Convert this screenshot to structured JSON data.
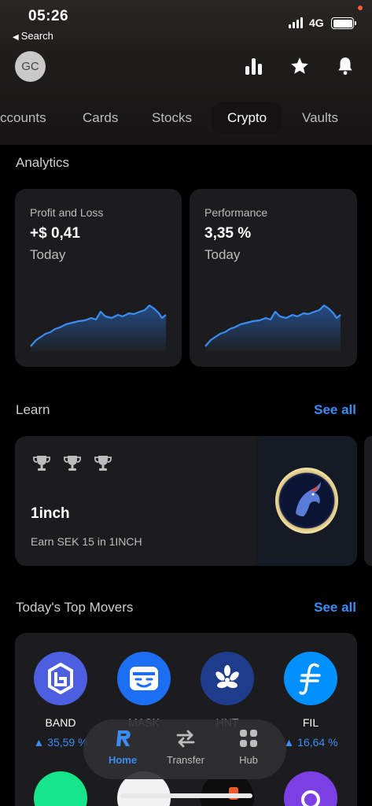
{
  "status_bar": {
    "time": "05:26",
    "back_label": "Search",
    "network": "4G"
  },
  "header": {
    "avatar_initials": "GC"
  },
  "tabs": [
    {
      "label": "ccounts"
    },
    {
      "label": "Cards"
    },
    {
      "label": "Stocks"
    },
    {
      "label": "Crypto",
      "active": true
    },
    {
      "label": "Vaults"
    }
  ],
  "analytics": {
    "title": "Analytics",
    "profit_loss": {
      "label": "Profit and Loss",
      "value": "+$ 0,41",
      "period": "Today"
    },
    "performance": {
      "label": "Performance",
      "value": "3,35 %",
      "period": "Today"
    }
  },
  "learn": {
    "title": "Learn",
    "see_all": "See all",
    "card": {
      "title": "1inch",
      "subtitle": "Earn SEK 15 in 1INCH"
    }
  },
  "movers": {
    "title": "Today's Top Movers",
    "see_all": "See all",
    "items": [
      {
        "symbol": "BAND",
        "change": "▲ 35,59 %",
        "color": "#4c5fe0"
      },
      {
        "symbol": "MASK",
        "change": "",
        "color": "#1c6ef2"
      },
      {
        "symbol": "HNT",
        "change": "",
        "color": "#1f3c8c"
      },
      {
        "symbol": "FIL",
        "change": "▲ 16,64 %",
        "color": "#0090ff"
      }
    ]
  },
  "bottom_nav": [
    {
      "label": "Home",
      "active": true
    },
    {
      "label": "Transfer"
    },
    {
      "label": "Hub"
    }
  ],
  "colors": {
    "accent": "#3b8cf5",
    "card_bg": "#1c1c1e",
    "background": "#000000"
  }
}
